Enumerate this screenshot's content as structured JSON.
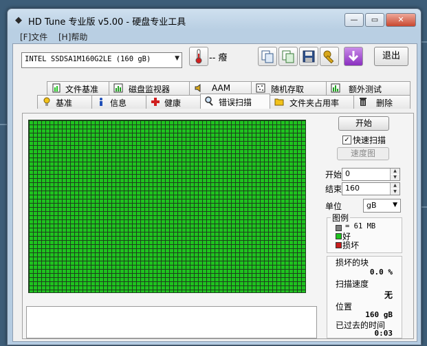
{
  "window": {
    "title": "HD Tune 专业版 v5.00 - 硬盘专业工具"
  },
  "menu": [
    {
      "label": "[F]文件"
    },
    {
      "label": "[H]帮助"
    }
  ],
  "toolbar": {
    "drive": "INTEL SSDSA1M160G2LE (160 gB)",
    "temperature": "-- 癈",
    "exit_label": "退出"
  },
  "tabs_top": [
    {
      "label": "文件基准",
      "icon": "file-benchmark-icon"
    },
    {
      "label": "磁盘监视器",
      "icon": "disk-monitor-icon"
    },
    {
      "label": "AAM",
      "icon": "speaker-icon"
    },
    {
      "label": "随机存取",
      "icon": "random-access-icon"
    },
    {
      "label": "额外测试",
      "icon": "extra-tests-icon"
    }
  ],
  "tabs_bottom": [
    {
      "label": "基准",
      "icon": "benchmark-icon"
    },
    {
      "label": "信息",
      "icon": "info-icon"
    },
    {
      "label": "健康",
      "icon": "health-cross-icon"
    },
    {
      "label": "错误扫描",
      "icon": "magnifier-icon",
      "active": true
    },
    {
      "label": "文件夹占用率",
      "icon": "folder-icon"
    },
    {
      "label": "删除",
      "icon": "trash-icon"
    }
  ],
  "scan": {
    "start_button": "开始",
    "quick_scan_label": "快速扫描",
    "quick_scan_checked": true,
    "speed_map_button": "速度图",
    "start_label": "开始",
    "start_value": "0",
    "end_label": "结束",
    "end_value": "160",
    "unit_label": "单位",
    "unit_value": "gB"
  },
  "legend": {
    "title": "图例",
    "block_size": "= 61 MB",
    "good_label": "好",
    "bad_label": "损坏",
    "colors": {
      "block": "#7f7f7f",
      "good": "#1fc31f",
      "bad": "#c81e1e"
    }
  },
  "stats": {
    "damaged_label": "损坏的块",
    "damaged_value": "0.0 %",
    "speed_label": "扫描速度",
    "speed_value": "无",
    "position_label": "位置",
    "position_value": "160 gB",
    "elapsed_label": "已过去的时间",
    "elapsed_value": "0:03"
  }
}
